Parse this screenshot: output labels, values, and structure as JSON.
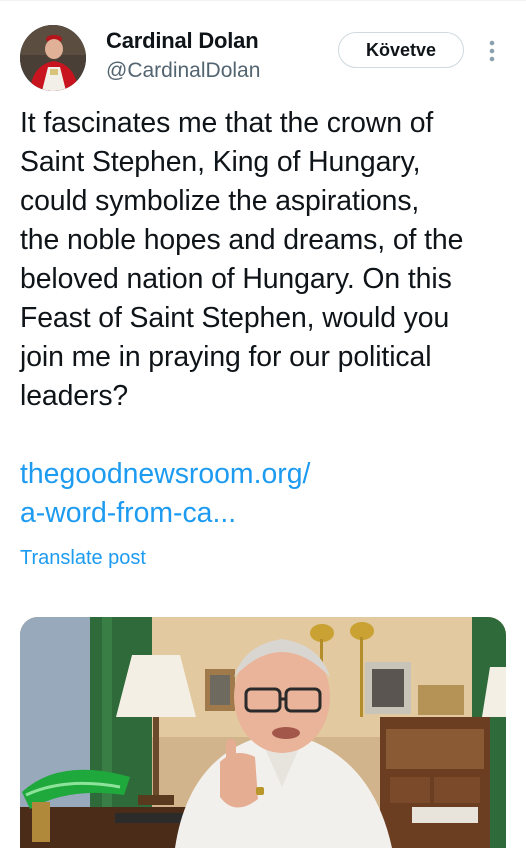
{
  "author": {
    "display_name": "Cardinal Dolan",
    "handle": "@CardinalDolan",
    "follow_label": "Követve"
  },
  "post": {
    "text_lines": [
      "It fascinates me that the crown of",
      "Saint Stephen, King of Hungary,",
      "could symbolize the aspirations,",
      "the noble hopes and dreams, of the",
      "beloved nation of Hungary. On this",
      "Feast of Saint Stephen, would you",
      "join me in praying for our political",
      "leaders?"
    ],
    "link_lines": [
      "thegoodnewsroom.org/",
      "a-word-from-ca..."
    ],
    "translate_label": "Translate post"
  },
  "icons": {
    "more": "more-vertical-icon"
  },
  "colors": {
    "link": "#1d9bf0",
    "secondary_text": "#536471",
    "primary_text": "#0f1419",
    "border": "#cfd9de"
  }
}
